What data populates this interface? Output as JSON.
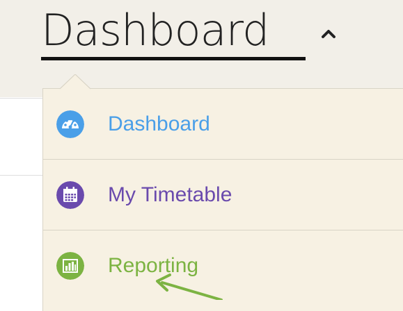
{
  "header": {
    "title": "Dashboard"
  },
  "menu": {
    "items": [
      {
        "label": "Dashboard",
        "icon": "dashboard-gauge-icon",
        "color": "#4a9fe8"
      },
      {
        "label": "My Timetable",
        "icon": "calendar-icon",
        "color": "#6a4aad"
      },
      {
        "label": "Reporting",
        "icon": "bar-chart-icon",
        "color": "#7cb342"
      }
    ]
  },
  "colors": {
    "header_bg": "#f2efe8",
    "dropdown_bg": "#f7f1e3",
    "annotation_arrow": "#7cb342"
  }
}
